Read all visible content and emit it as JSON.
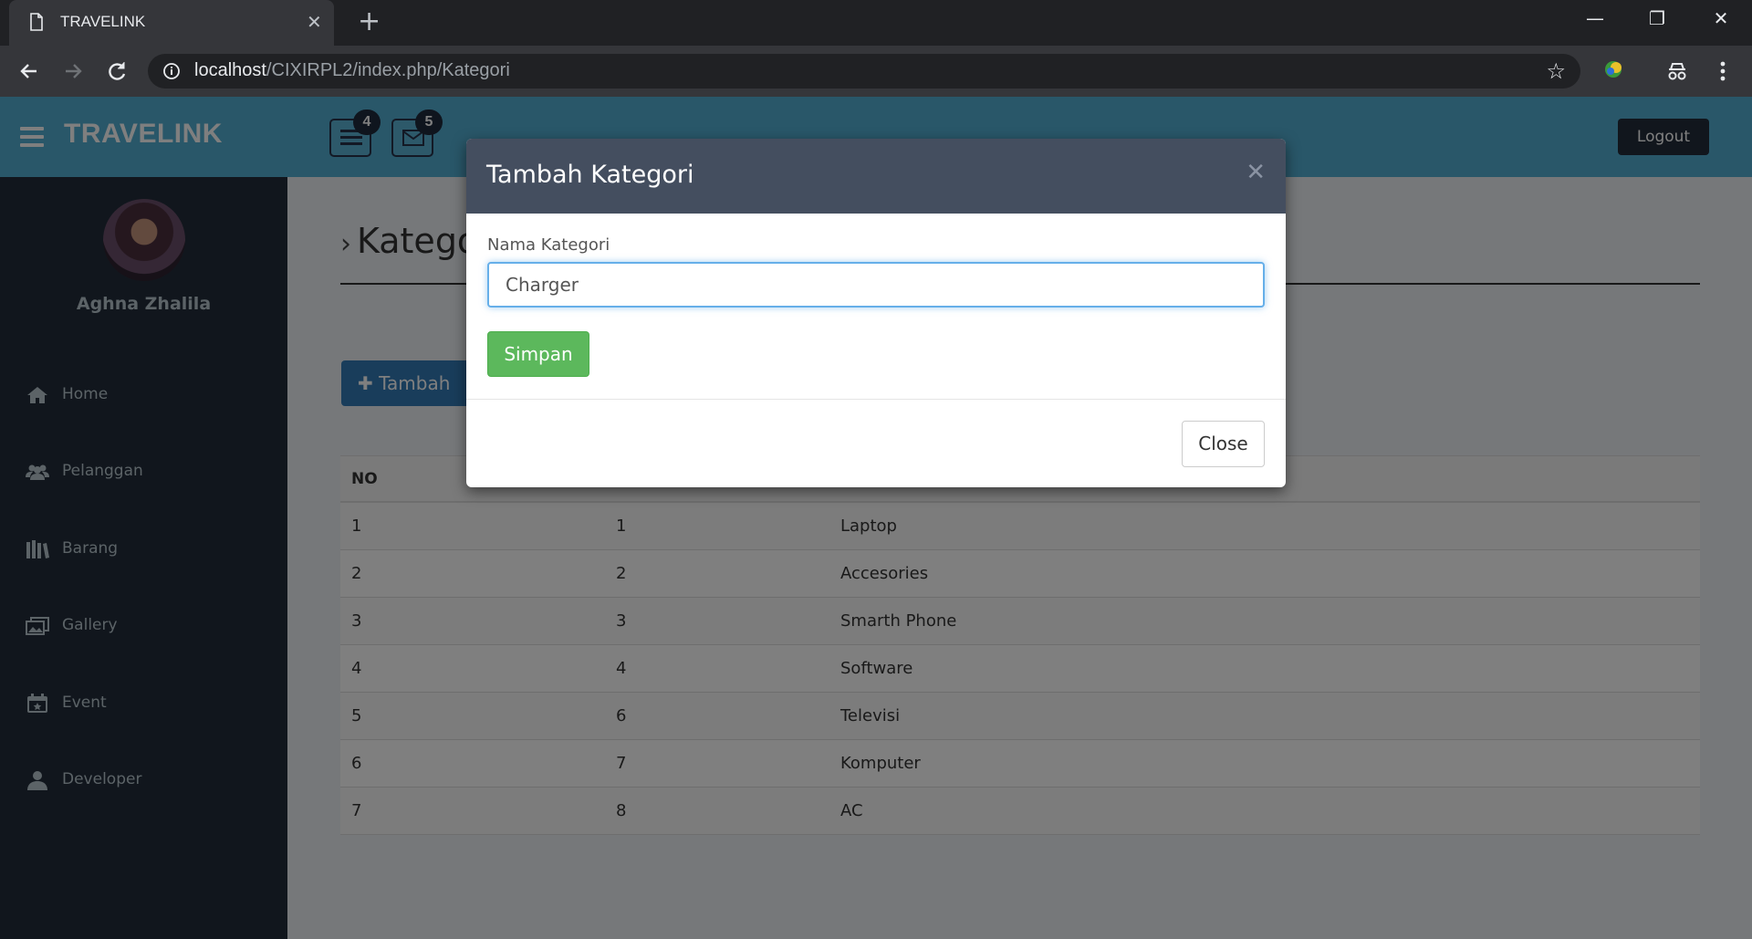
{
  "browser": {
    "tab_title": "TRAVELINK",
    "url_host": "localhost",
    "url_path": "/CIXIRPL2/index.php/Kategori"
  },
  "app": {
    "brand": "TRAVELINK",
    "tasks_badge": "4",
    "mail_badge": "5",
    "logout_label": "Logout"
  },
  "sidebar": {
    "user_name": "Aghna Zhalila",
    "items": [
      {
        "label": "Home",
        "icon": "home-icon"
      },
      {
        "label": "Pelanggan",
        "icon": "users-icon"
      },
      {
        "label": "Barang",
        "icon": "books-icon"
      },
      {
        "label": "Gallery",
        "icon": "gallery-icon"
      },
      {
        "label": "Event",
        "icon": "calendar-icon"
      },
      {
        "label": "Developer",
        "icon": "user-icon"
      }
    ]
  },
  "main": {
    "page_title": "Kategori",
    "add_label": "Tambah",
    "table": {
      "headers": [
        "NO"
      ],
      "rows": [
        [
          "1",
          "1",
          "Laptop"
        ],
        [
          "2",
          "2",
          "Accesories"
        ],
        [
          "3",
          "3",
          "Smarth Phone"
        ],
        [
          "4",
          "4",
          "Software"
        ],
        [
          "5",
          "6",
          "Televisi"
        ],
        [
          "6",
          "7",
          "Komputer"
        ],
        [
          "7",
          "8",
          "AC"
        ]
      ]
    }
  },
  "modal": {
    "title": "Tambah Kategori",
    "field_label": "Nama Kategori",
    "field_value": "Charger",
    "save_label": "Simpan",
    "close_label": "Close"
  },
  "colors": {
    "topbar": "#53aed2",
    "sidebar": "#222d3b",
    "modal_header": "#444e5f",
    "save": "#5cb85c",
    "primary": "#337ab7"
  }
}
